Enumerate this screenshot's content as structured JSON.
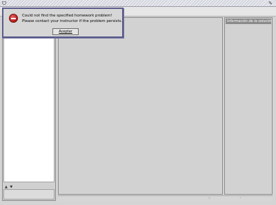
{
  "window": {
    "app_icon": "app-icon",
    "corner_icon": "edit-icon"
  },
  "dialog": {
    "icon": "error-icon",
    "message_line1": "Could not find the specified homework problem!",
    "message_line2": "Please contact your instructor if the problem persists.",
    "ok_label": "Aceptar"
  },
  "right_panel": {
    "header": "Información de la solución"
  },
  "left_panel": {
    "arrows": "▲ ▼"
  },
  "colors": {
    "error": "#b01818",
    "dialog_border": "#5a5a8c",
    "panel_header": "#8a8a8a"
  }
}
